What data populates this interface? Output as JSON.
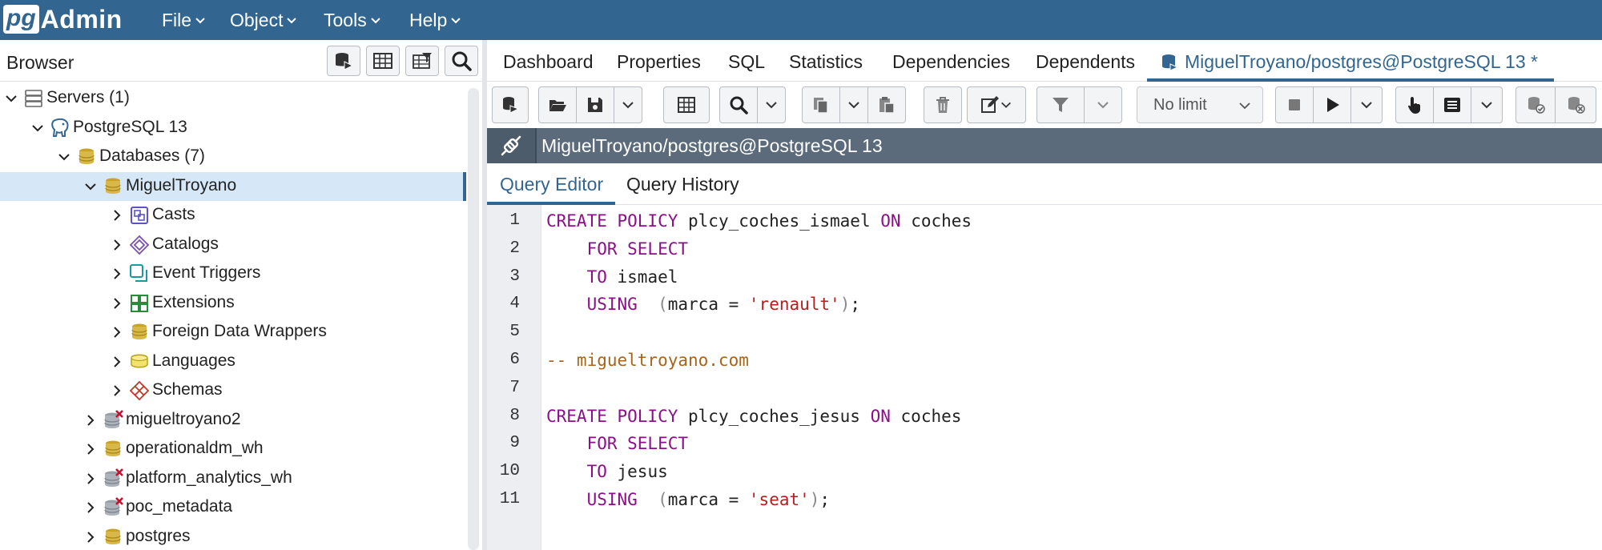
{
  "app": {
    "logo_pg": "pg",
    "logo_text": "Admin",
    "menus": [
      "File",
      "Object",
      "Tools",
      "Help"
    ]
  },
  "browser": {
    "title": "Browser",
    "tree": [
      {
        "label": "Servers (1)",
        "level": 0,
        "expanded": true,
        "icon": "servers-icon"
      },
      {
        "label": "PostgreSQL 13",
        "level": 1,
        "expanded": true,
        "icon": "postgresql-elephant-icon"
      },
      {
        "label": "Databases (7)",
        "level": 2,
        "expanded": true,
        "icon": "databases-icon"
      },
      {
        "label": "MiguelTroyano",
        "level": 3,
        "expanded": true,
        "icon": "database-icon",
        "selected": true
      },
      {
        "label": "Casts",
        "level": 4,
        "expanded": false,
        "icon": "casts-icon"
      },
      {
        "label": "Catalogs",
        "level": 4,
        "expanded": false,
        "icon": "catalogs-icon"
      },
      {
        "label": "Event Triggers",
        "level": 4,
        "expanded": false,
        "icon": "event-triggers-icon"
      },
      {
        "label": "Extensions",
        "level": 4,
        "expanded": false,
        "icon": "extensions-icon"
      },
      {
        "label": "Foreign Data Wrappers",
        "level": 4,
        "expanded": false,
        "icon": "foreign-data-wrappers-icon"
      },
      {
        "label": "Languages",
        "level": 4,
        "expanded": false,
        "icon": "languages-icon"
      },
      {
        "label": "Schemas",
        "level": 4,
        "expanded": false,
        "icon": "schemas-icon"
      },
      {
        "label": "migueltroyano2",
        "level": 3,
        "expanded": false,
        "icon": "database-disconnected-icon"
      },
      {
        "label": "operationaldm_wh",
        "level": 3,
        "expanded": false,
        "icon": "database-icon"
      },
      {
        "label": "platform_analytics_wh",
        "level": 3,
        "expanded": false,
        "icon": "database-disconnected-icon"
      },
      {
        "label": "poc_metadata",
        "level": 3,
        "expanded": false,
        "icon": "database-disconnected-icon"
      },
      {
        "label": "postgres",
        "level": 3,
        "expanded": false,
        "icon": "database-icon"
      }
    ]
  },
  "tabs": [
    {
      "label": "Dashboard"
    },
    {
      "label": "Properties"
    },
    {
      "label": "SQL"
    },
    {
      "label": "Statistics"
    },
    {
      "label": "Dependencies"
    },
    {
      "label": "Dependents"
    },
    {
      "label": "MiguelTroyano/postgres@PostgreSQL 13 *",
      "active": true
    }
  ],
  "toolbar": {
    "limit_value": "No limit"
  },
  "connection": {
    "label": "MiguelTroyano/postgres@PostgreSQL 13"
  },
  "subtabs": [
    {
      "label": "Query Editor",
      "active": true
    },
    {
      "label": "Query History"
    }
  ],
  "editor": {
    "line_numbers": [
      "1",
      "2",
      "3",
      "4",
      "5",
      "6",
      "7",
      "8",
      "9",
      "10",
      "11"
    ],
    "lines": [
      [
        {
          "t": "kw",
          "v": "CREATE POLICY"
        },
        {
          "t": "txt",
          "v": " plcy_coches_ismael "
        },
        {
          "t": "kw",
          "v": "ON"
        },
        {
          "t": "txt",
          "v": " coches"
        }
      ],
      [
        {
          "t": "txt",
          "v": "    "
        },
        {
          "t": "kw",
          "v": "FOR SELECT"
        }
      ],
      [
        {
          "t": "txt",
          "v": "    "
        },
        {
          "t": "kw",
          "v": "TO"
        },
        {
          "t": "txt",
          "v": " ismael"
        }
      ],
      [
        {
          "t": "txt",
          "v": "    "
        },
        {
          "t": "kw",
          "v": "USING"
        },
        {
          "t": "txt",
          "v": "  "
        },
        {
          "t": "paren",
          "v": "("
        },
        {
          "t": "txt",
          "v": "marca = "
        },
        {
          "t": "str",
          "v": "'renault'"
        },
        {
          "t": "paren",
          "v": ")"
        },
        {
          "t": "txt",
          "v": ";"
        }
      ],
      [],
      [
        {
          "t": "cmt",
          "v": "-- migueltroyano.com"
        }
      ],
      [],
      [
        {
          "t": "kw",
          "v": "CREATE POLICY"
        },
        {
          "t": "txt",
          "v": " plcy_coches_jesus "
        },
        {
          "t": "kw",
          "v": "ON"
        },
        {
          "t": "txt",
          "v": " coches"
        }
      ],
      [
        {
          "t": "txt",
          "v": "    "
        },
        {
          "t": "kw",
          "v": "FOR SELECT"
        }
      ],
      [
        {
          "t": "txt",
          "v": "    "
        },
        {
          "t": "kw",
          "v": "TO"
        },
        {
          "t": "txt",
          "v": " jesus"
        }
      ],
      [
        {
          "t": "txt",
          "v": "    "
        },
        {
          "t": "kw",
          "v": "USING"
        },
        {
          "t": "txt",
          "v": "  "
        },
        {
          "t": "paren",
          "v": "("
        },
        {
          "t": "txt",
          "v": "marca = "
        },
        {
          "t": "str",
          "v": "'seat'"
        },
        {
          "t": "paren",
          "v": ")"
        },
        {
          "t": "txt",
          "v": ";"
        }
      ]
    ]
  },
  "colors": {
    "brand": "#326690",
    "selection": "#d6e8f7",
    "keyword": "#8b0f88",
    "string": "#b51f1f",
    "comment": "#a8641a",
    "connection_bar": "#5b6b7b"
  }
}
